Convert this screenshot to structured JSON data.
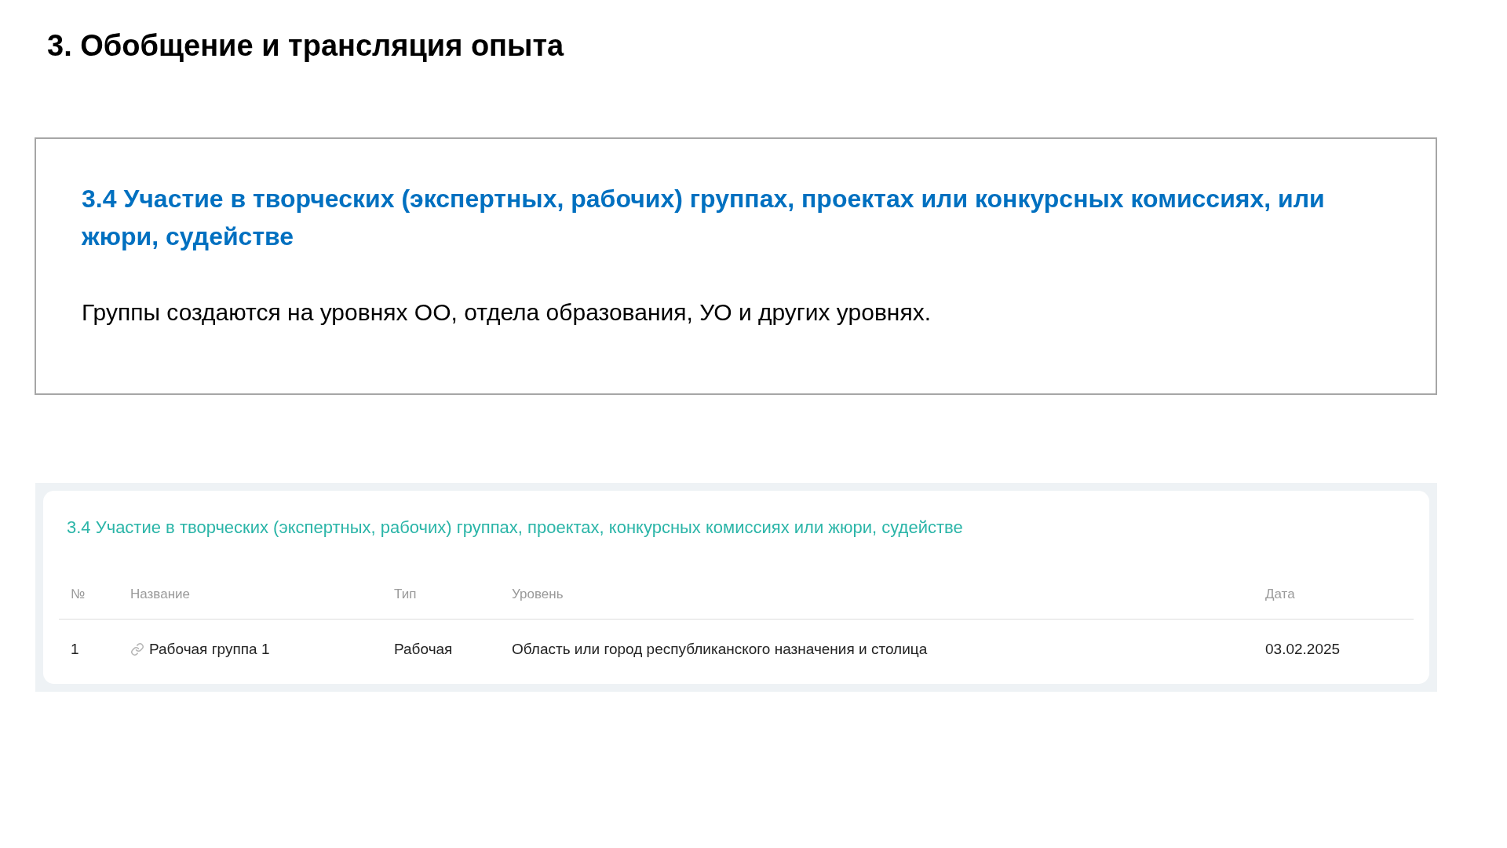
{
  "heading": "3. Обобщение и трансляция опыта",
  "info_box": {
    "title": "3.4 Участие в творческих (экспертных, рабочих) группах, проектах или конкурсных комиссиях, или жюри, судействе",
    "text": "Группы создаются на уровнях ОО, отдела образования, УО и других уровнях."
  },
  "table_card": {
    "title": "3.4 Участие в творческих (экспертных, рабочих) группах, проектах, конкурсных комиссиях или жюри, судействе",
    "columns": [
      "№",
      "Название",
      "Тип",
      "Уровень",
      "Дата"
    ],
    "rows": [
      {
        "cells": [
          "1",
          "Рабочая группа 1",
          "Рабочая",
          "Область или город республиканского назначения и столица",
          "03.02.2025"
        ],
        "linked": true
      }
    ]
  }
}
